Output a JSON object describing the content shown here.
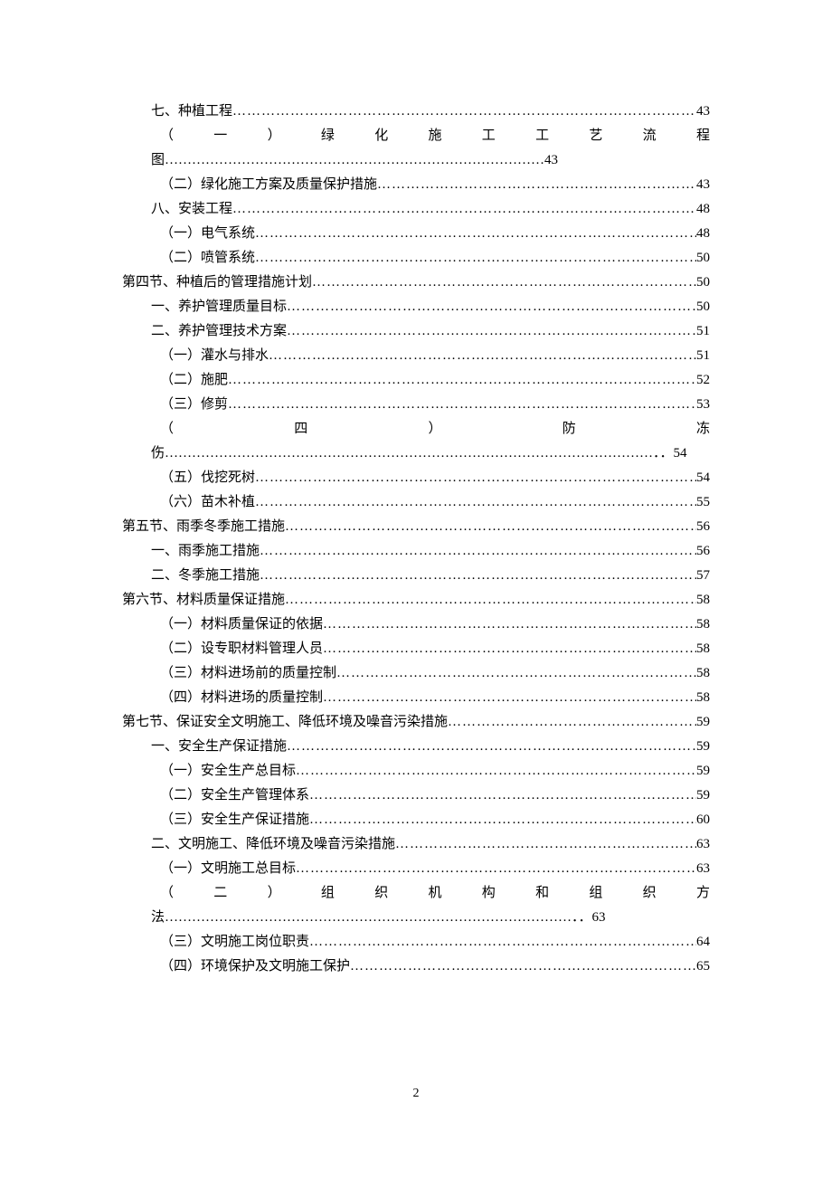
{
  "toc": [
    {
      "label": "七、种植工程",
      "page": "43",
      "indent": 1,
      "dotStyle": "double"
    },
    {
      "label": "（一）绿化施工工艺流程图",
      "page": "43",
      "indent": 2,
      "justify": true,
      "justChars": [
        "（",
        "一",
        "）",
        "绿",
        "化",
        "施",
        "工",
        "工",
        "艺",
        "流",
        "程"
      ],
      "lastChar": "图"
    },
    {
      "label": "（二）绿化施工方案及质量保护措施",
      "page": "43",
      "indent": 2
    },
    {
      "label": "八、安装工程",
      "page": "48",
      "indent": 1
    },
    {
      "label": "（一）电气系统",
      "page": "48",
      "indent": 2
    },
    {
      "label": "（二）喷管系统",
      "page": "50",
      "indent": 2
    },
    {
      "label": "第四节、种植后的管理措施计划",
      "page": "50",
      "indent": 0
    },
    {
      "label": "一、养护管理质量目标",
      "page": "50",
      "indent": 1
    },
    {
      "label": "二、养护管理技术方案",
      "page": "51",
      "indent": 1
    },
    {
      "label": "（一）灌水与排水",
      "page": "51",
      "indent": 2,
      "dotStyle": "double"
    },
    {
      "label": "（二）施肥",
      "page": "52",
      "indent": 2,
      "dotStyle": "double"
    },
    {
      "label": "（三）修剪",
      "page": "53",
      "indent": 2,
      "dotStyle": "double"
    },
    {
      "label": "（四）防冻伤",
      "page": "54",
      "indent": 2,
      "justify": true,
      "justChars": [
        "（",
        "四",
        "）",
        "防",
        "冻"
      ],
      "lastChar": "伤",
      "dotStyle": "double"
    },
    {
      "label": "（五）伐挖死树",
      "page": "54",
      "indent": 2
    },
    {
      "label": "（六）苗木补植",
      "page": "55",
      "indent": 2,
      "dotStyle": "double"
    },
    {
      "label": "第五节、雨季冬季施工措施",
      "page": "56",
      "indent": 0,
      "dotStyle": "double"
    },
    {
      "label": "一、雨季施工措施",
      "page": "56",
      "indent": 1,
      "dotStyle": "double"
    },
    {
      "label": "二、冬季施工措施",
      "page": "57",
      "indent": 1,
      "dotStyle": "double"
    },
    {
      "label": "第六节、材料质量保证措施",
      "page": "58",
      "indent": 0
    },
    {
      "label": "（一）材料质量保证的依据",
      "page": "58",
      "indent": 2
    },
    {
      "label": "（二）设专职材料管理人员",
      "page": "58",
      "indent": 2
    },
    {
      "label": "（三）材料进场前的质量控制",
      "page": "58",
      "indent": 2
    },
    {
      "label": "（四）材料进场的质量控制",
      "page": "58",
      "indent": 2
    },
    {
      "label": "第七节、保证安全文明施工、降低环境及噪音污染措施",
      "page": "59",
      "indent": 0,
      "dotStyle": "double"
    },
    {
      "label": "一、安全生产保证措施",
      "page": "59",
      "indent": 1,
      "dotStyle": "double"
    },
    {
      "label": "（一）安全生产总目标",
      "page": "59",
      "indent": 2,
      "dotStyle": "double"
    },
    {
      "label": "（二）安全生产管理体系",
      "page": "59",
      "indent": 2,
      "dotStyle": "double"
    },
    {
      "label": "（三）安全生产保证措施",
      "page": "60",
      "indent": 2
    },
    {
      "label": "二、文明施工、降低环境及噪音污染措施",
      "page": "63",
      "indent": 1,
      "dotStyle": "double"
    },
    {
      "label": "（一）文明施工总目标",
      "page": "63",
      "indent": 2
    },
    {
      "label": "（二）组织机构和组织方法",
      "page": "63",
      "indent": 2,
      "justify": true,
      "justChars": [
        "（",
        "二",
        "）",
        "组",
        "织",
        "机",
        "构",
        "和",
        "组",
        "织",
        "方"
      ],
      "lastChar": "法",
      "dotStyle": "double"
    },
    {
      "label": "（三）文明施工岗位职责",
      "page": "64",
      "indent": 2,
      "dotStyle": "double"
    },
    {
      "label": "（四）环境保护及文明施工保护",
      "page": "65",
      "indent": 2
    }
  ],
  "pageNumber": "2",
  "dots": "………………………………………………………………………………………………………………………………",
  "dotsDouble": "……………………………………………………………………………………………………………………………．．"
}
